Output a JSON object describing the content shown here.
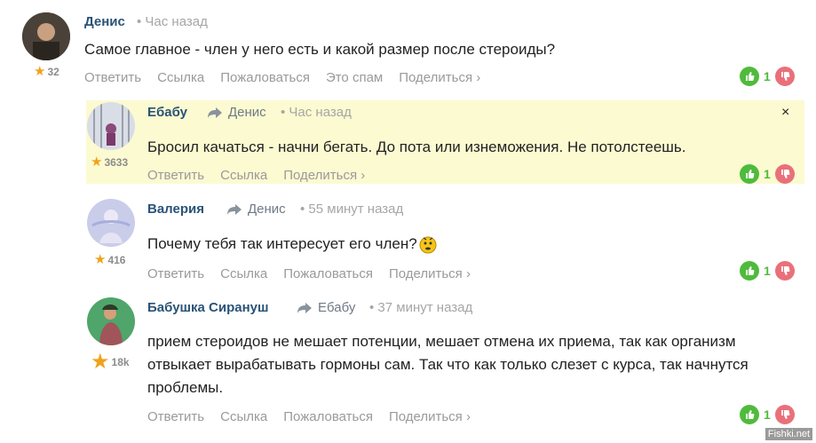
{
  "comments": [
    {
      "author": "Денис",
      "reply_to": "",
      "time": "• Час назад",
      "text": "Самое главное - член у него есть и какой размер после стероиды?",
      "rating": "32",
      "actions": [
        "Ответить",
        "Ссылка",
        "Пожаловаться",
        "Это спам",
        "Поделиться ›"
      ],
      "votes": "1"
    },
    {
      "author": "Ебабу",
      "reply_to": "Денис",
      "time": "• Час назад",
      "text": "Бросил качаться - начни бегать. До пота или изнеможения. Не потолстеешь.",
      "rating": "3633",
      "actions": [
        "Ответить",
        "Ссылка",
        "Поделиться ›"
      ],
      "votes": "1",
      "close": "×"
    },
    {
      "author": "Валерия",
      "reply_to": "Денис",
      "time": "• 55 минут назад",
      "text": "Почему тебя так интересует его член?",
      "rating": "416",
      "actions": [
        "Ответить",
        "Ссылка",
        "Пожаловаться",
        "Поделиться ›"
      ],
      "votes": "1"
    },
    {
      "author": "Бабушка Сирануш",
      "reply_to": "Ебабу",
      "time": "• 37 минут назад",
      "text": "прием стероидов не мешает потенции, мешает отмена их приема, так как организм отвыкает вырабатывать гормоны сам. Так что как только слезет с курса, так начнутся проблемы.",
      "rating": "18k",
      "actions": [
        "Ответить",
        "Ссылка",
        "Пожаловаться",
        "Поделиться ›"
      ],
      "votes": "1"
    }
  ],
  "watermark": "Fishki.net",
  "colors": {
    "highlight": "#fcfad1",
    "vote_up": "#4fbb3c",
    "vote_down": "#e9707a",
    "author": "#2a5377"
  }
}
